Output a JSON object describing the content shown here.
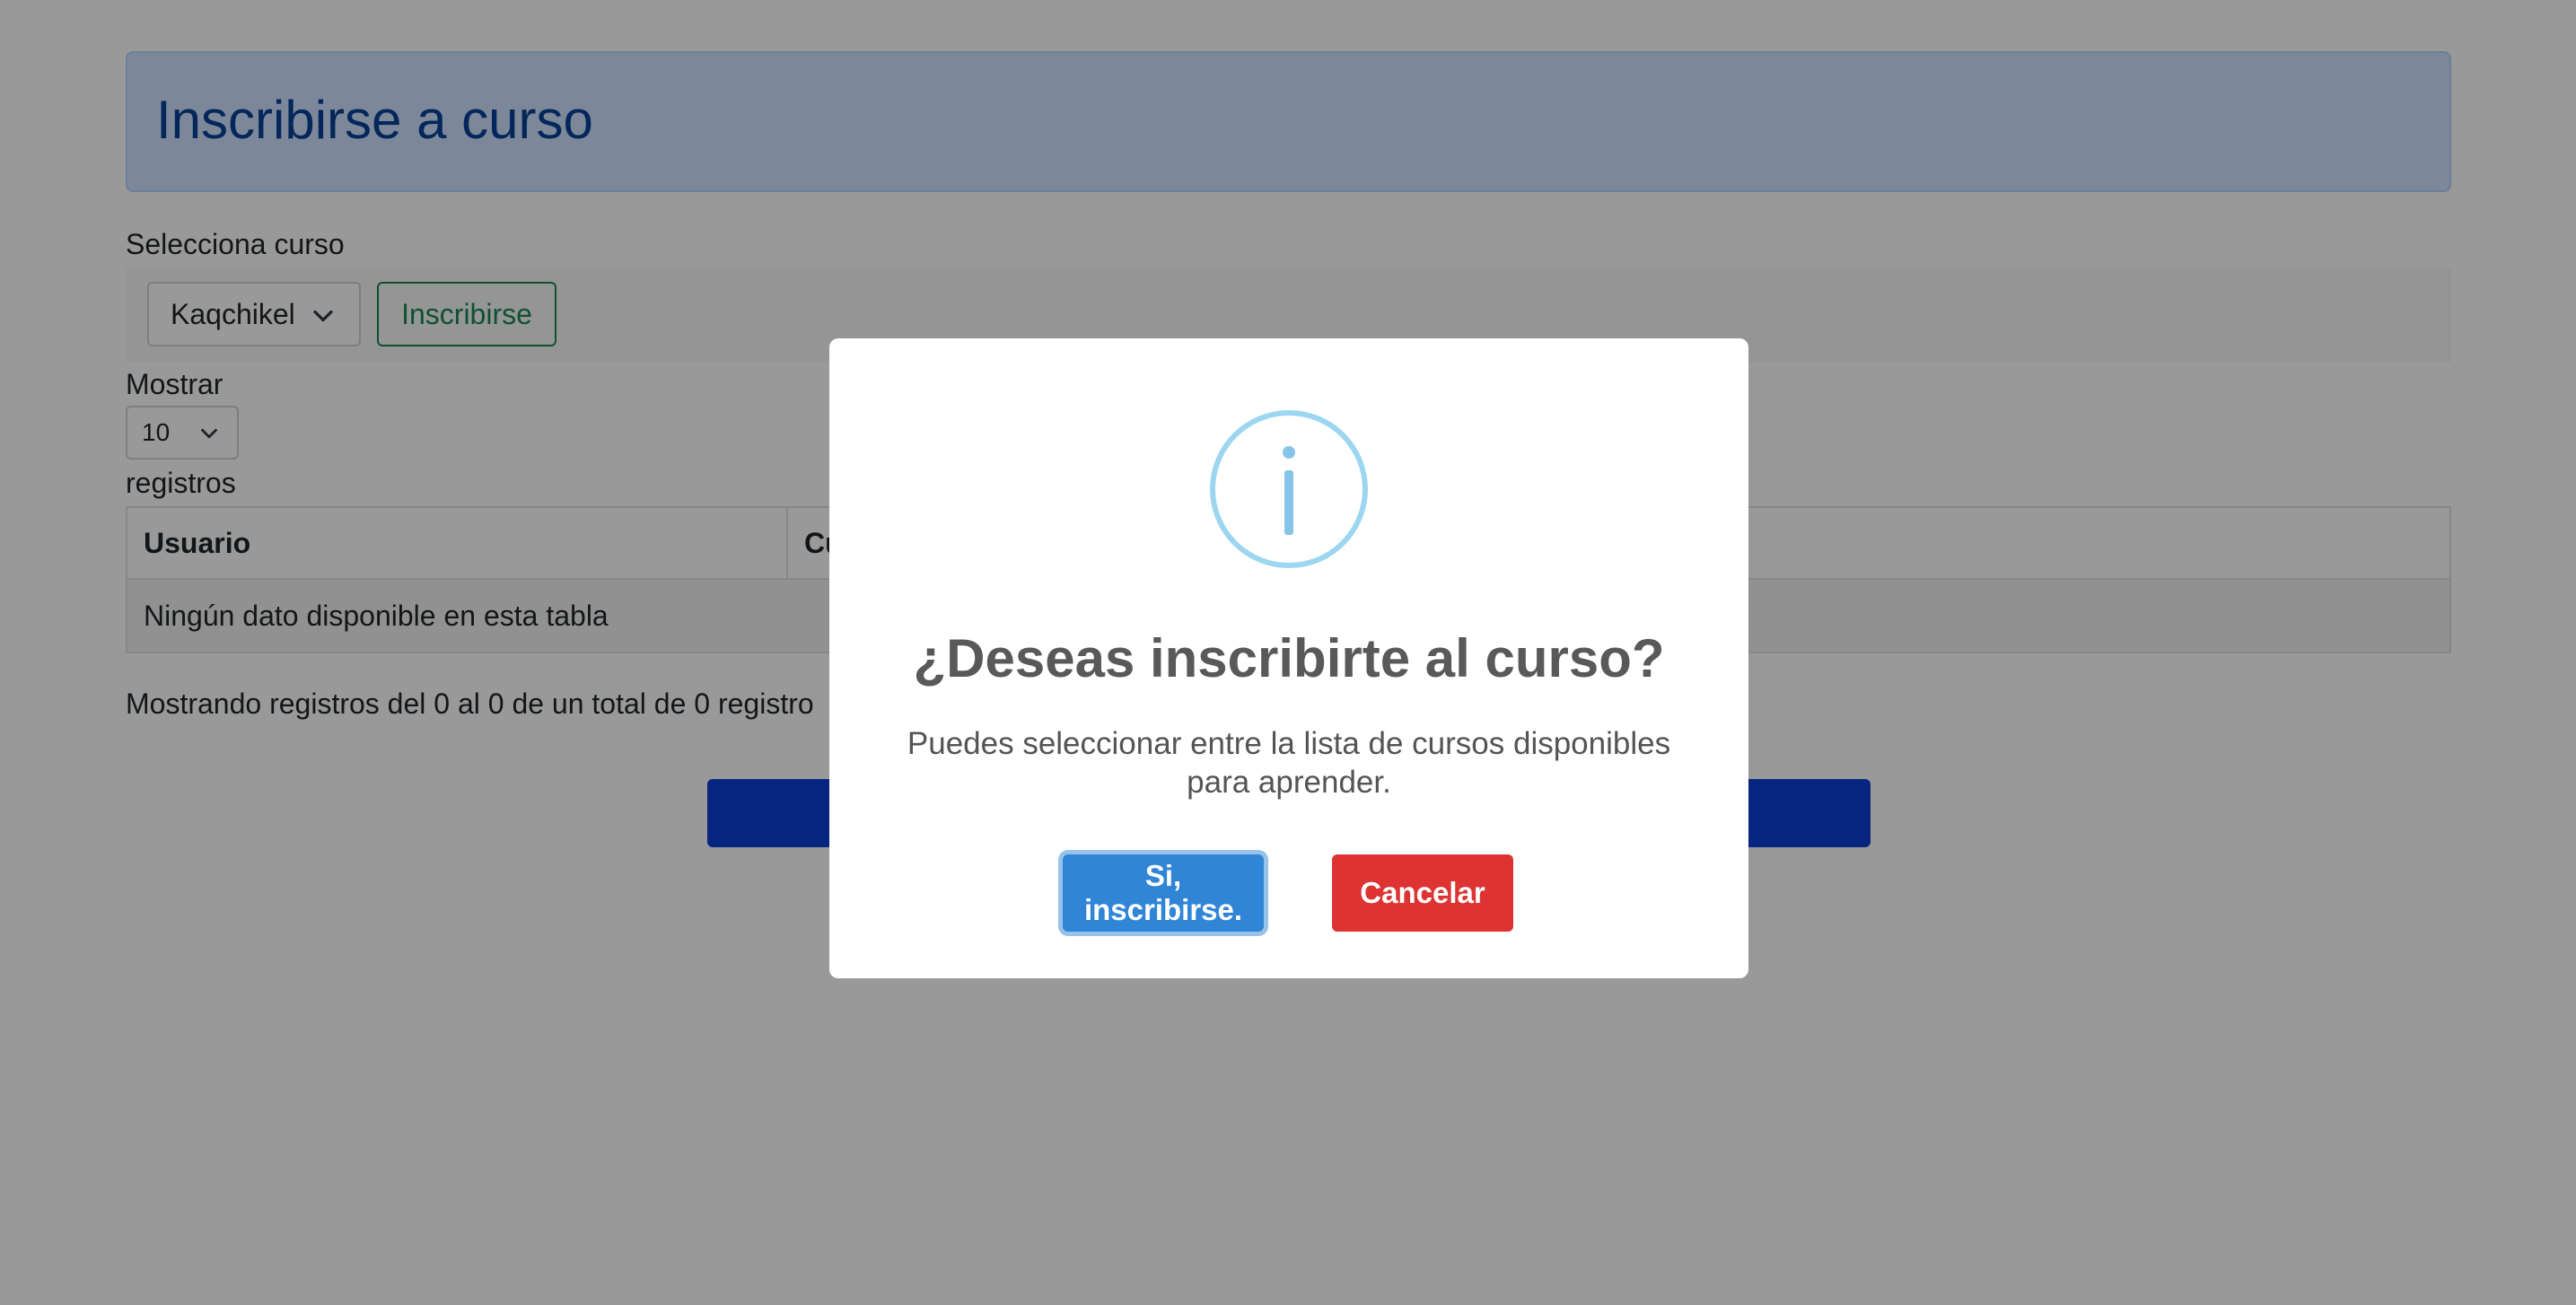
{
  "page": {
    "title": "Inscribirse a curso",
    "select_label": "Selecciona curso",
    "selected_course": "Kaqchikel",
    "enroll_label": "Inscribirse",
    "show_label": "Mostrar",
    "page_length": "10",
    "records_label": "registros",
    "table": {
      "headers": [
        "Usuario",
        "Cu"
      ],
      "empty_message": "Ningún dato disponible en esta tabla"
    },
    "info": "Mostrando registros del 0 al 0 de un total de 0 registro"
  },
  "modal": {
    "icon": "info-icon",
    "icon_glyph": "i",
    "title": "¿Deseas inscribirte al curso?",
    "text": "Puedes seleccionar entre la lista de cursos disponibles para aprender.",
    "confirm_label": "Si, inscribirse.",
    "cancel_label": "Cancelar"
  },
  "colors": {
    "confirm": "#3085d6",
    "cancel": "#dd3333",
    "info_icon": "#9dd6f0",
    "header_bg": "#cfe2ff",
    "header_text": "#084298"
  }
}
